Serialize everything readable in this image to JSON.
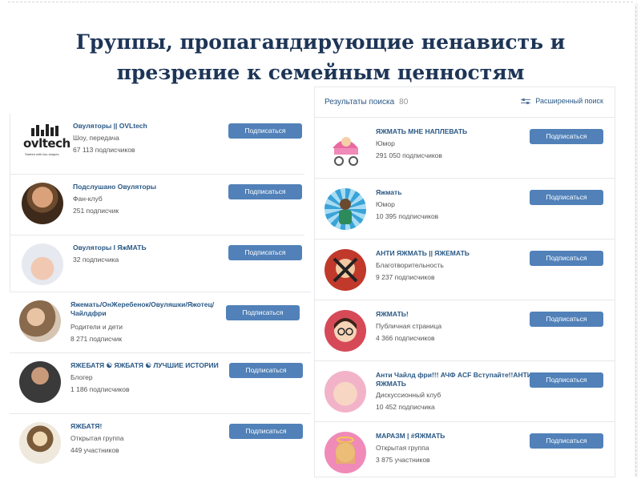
{
  "slide_title": "Группы, пропагандирующие ненависть и презрение к семейным ценностям",
  "search": {
    "title": "Результаты поиска",
    "count": "80",
    "advanced": "Расширенный поиск"
  },
  "subscribe_label": "Подписаться",
  "left_top_groups": [
    {
      "name": "Овуляторы || OVLtech",
      "type": "Шоу, передача",
      "subs": "67 113 подписчиков",
      "avatar": "ovltech-logo"
    },
    {
      "name": "Подслушано Овуляторы",
      "type": "Фан-клуб",
      "subs": "251 подписчик",
      "avatar": "man-photo"
    },
    {
      "name": "Овуляторы I ЯжМАТЬ",
      "type": "32 подписчика",
      "subs": "",
      "avatar": "pregnant-photo"
    }
  ],
  "left_bottom_groups": [
    {
      "name": "Яжемать/ОнЖеребенок/Овуляшки/Яжотец/",
      "name2": "Чайлдфри",
      "type": "Родители и дети",
      "subs": "8 271 подписчик",
      "avatar": "family-photo"
    },
    {
      "name": "ЯЖЕБАТЯ ☯ ЯЖБАТЯ ☯ ЛУЧШИЕ ИСТОРИИ",
      "type": "Блогер",
      "subs": "1 186 подписчиков",
      "avatar": "man-photo-2"
    },
    {
      "name": "ЯЖБАТЯ!",
      "type": "Открытая группа",
      "subs": "449 участников",
      "avatar": "man-drawing"
    }
  ],
  "right_groups": [
    {
      "name": "ЯЖМАТЬ МНЕ НАПЛЕВАТЬ",
      "type": "Юмор",
      "subs": "291 050 подписчиков",
      "avatar": "stroller-icon"
    },
    {
      "name": "Яжмать",
      "type": "Юмор",
      "subs": "10 395 подписчиков",
      "avatar": "sunburst-figure"
    },
    {
      "name": "АНТИ ЯЖМАТЬ || ЯЖЕМАТЬ",
      "type": "Благотворительность",
      "subs": "9 237 подписчиков",
      "avatar": "crossed-woman"
    },
    {
      "name": "ЯЖМАТЬ!",
      "type": "Публичная страница",
      "subs": "4 366 подписчиков",
      "avatar": "woman-glasses"
    },
    {
      "name": "Анти Чайлд фри!!! АЧФ ACF Вступайте!!АНТИ",
      "name2": "ЯЖМАТЬ",
      "type": "Дискуссионный клуб",
      "subs": "10 452 подписчика",
      "avatar": "baby-photo"
    },
    {
      "name": "МАРАЗМ | #ЯЖМАТЬ",
      "type": "Открытая группа",
      "subs": "3 875 участников",
      "avatar": "angel-woman"
    }
  ],
  "colors": {
    "title": "#1d3557",
    "link": "#2a5885",
    "button": "#5181b8"
  }
}
